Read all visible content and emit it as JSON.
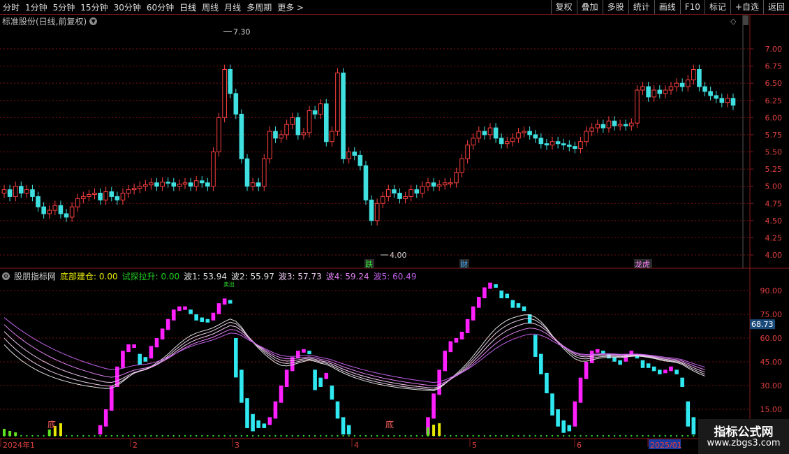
{
  "toolbar": {
    "periods": [
      "分时",
      "1分钟",
      "5分钟",
      "15分钟",
      "30分钟",
      "60分钟",
      "日线",
      "周线",
      "月线",
      "多周期",
      "更多 >"
    ],
    "buttons": [
      "复权",
      "叠加",
      "多股",
      "统计",
      "画线",
      "F10",
      "标记",
      "+自选",
      "返回"
    ]
  },
  "stock_title": "标准股份(日线,前复权)",
  "price_axis": [
    "7.00",
    "6.75",
    "6.50",
    "6.25",
    "6.00",
    "5.75",
    "5.50",
    "5.25",
    "5.00",
    "4.75",
    "4.50",
    "4.25",
    "4.00"
  ],
  "price_labels": {
    "high": "7.30",
    "low": "4.00"
  },
  "event_marks": [
    "跌",
    "财",
    "龙虎"
  ],
  "indicator": {
    "name": "股朋指标网",
    "items": [
      {
        "label": "底部建仓: 0.00",
        "color": "#e8e800"
      },
      {
        "label": "试探拉升: 0.00",
        "color": "#20d020"
      },
      {
        "label": "波1: 53.94",
        "color": "#e0e0e0"
      },
      {
        "label": "波2: 55.97",
        "color": "#e0e0e0"
      },
      {
        "label": "波3: 57.73",
        "color": "#f0c8f0"
      },
      {
        "label": "波4: 59.24",
        "color": "#e080f0"
      },
      {
        "label": "波5: 60.49",
        "color": "#c060e8"
      }
    ],
    "value_badge": "68.73"
  },
  "ind_axis": [
    "90.00",
    "75.00",
    "60.00",
    "45.00",
    "30.00",
    "15.00"
  ],
  "annotations": {
    "bottom": "底",
    "top_tag": "卖出"
  },
  "date_axis": [
    "2024年1",
    "2",
    "3",
    "4",
    "5",
    "6",
    "2025/01"
  ],
  "watermark": {
    "title": "指标公式网",
    "url": "www.zbgs3.com"
  },
  "colors": {
    "up": "#ff4040",
    "down": "#40e0e0",
    "magenta": "#ff20ff",
    "cyan": "#30e8f0",
    "grid": "#7a1010"
  }
}
